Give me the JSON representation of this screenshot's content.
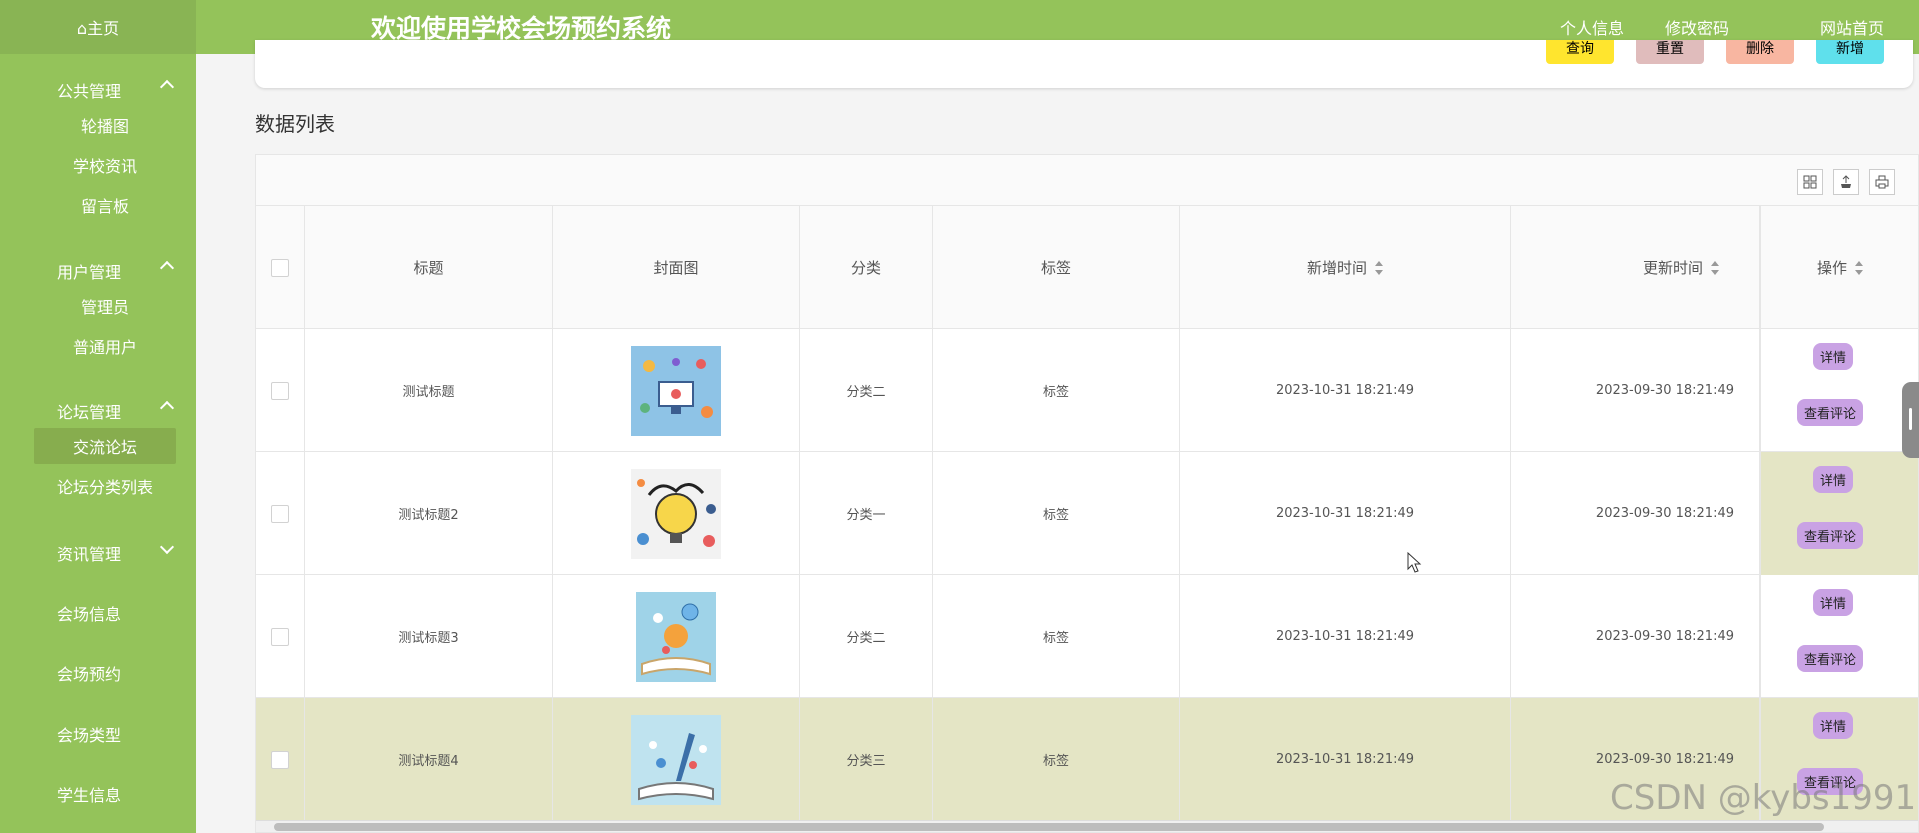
{
  "sidebar": {
    "home_label": "⌂主页",
    "groups": [
      {
        "title": "公共管理",
        "items": [
          "轮播图",
          "学校资讯",
          "留言板"
        ]
      },
      {
        "title": "用户管理",
        "items": [
          "管理员",
          "普通用户"
        ]
      },
      {
        "title": "论坛管理",
        "items": [
          "交流论坛",
          "论坛分类列表"
        ]
      },
      {
        "title": "资讯管理",
        "items": []
      }
    ],
    "single_items": [
      "会场信息",
      "会场预约",
      "会场类型",
      "学生信息"
    ],
    "active_item": "交流论坛"
  },
  "header": {
    "title": "欢迎使用学校会场预约系统",
    "links": [
      "个人信息",
      "修改密码",
      "网站首页"
    ]
  },
  "search_toolbar": {
    "buttons": [
      {
        "label": "查询",
        "color": "#ffe52e"
      },
      {
        "label": "重置",
        "color": "#e0bcbc"
      },
      {
        "label": "删除",
        "color": "#f8b6a1"
      },
      {
        "label": "新增",
        "color": "#5fe0ec"
      }
    ]
  },
  "section_title": "数据列表",
  "table": {
    "columns": [
      "标题",
      "封面图",
      "分类",
      "标签",
      "新增时间",
      "更新时间",
      "操作"
    ],
    "rows": [
      {
        "title": "测试标题",
        "category": "分类二",
        "tag": "标签",
        "created": "2023-10-31 18:21:49",
        "updated": "2023-09-30 18:21:49"
      },
      {
        "title": "测试标题2",
        "category": "分类一",
        "tag": "标签",
        "created": "2023-10-31 18:21:49",
        "updated": "2023-09-30 18:21:49"
      },
      {
        "title": "测试标题3",
        "category": "分类二",
        "tag": "标签",
        "created": "2023-10-31 18:21:49",
        "updated": "2023-09-30 18:21:49"
      },
      {
        "title": "测试标题4",
        "category": "分类三",
        "tag": "标签",
        "created": "2023-10-31 18:21:49",
        "updated": "2023-09-30 18:21:49"
      }
    ],
    "actions": [
      "详情",
      "查看评论"
    ]
  },
  "watermark": "CSDN @kybs1991",
  "colors": {
    "green": "#94c35a",
    "highlight_row": "#e4e5c5",
    "action_button": "#c9a2e4"
  }
}
